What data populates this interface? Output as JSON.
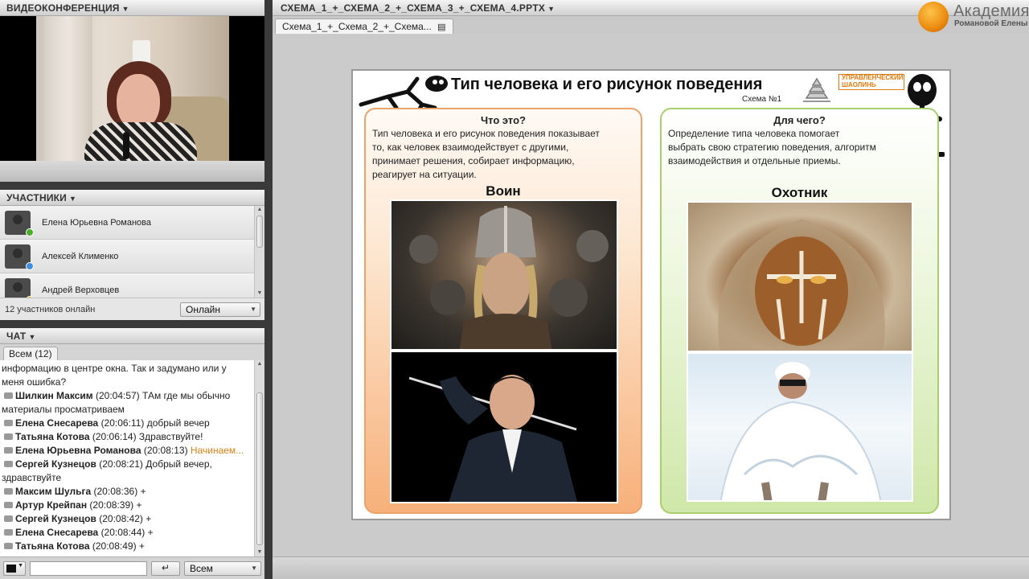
{
  "video_pod": {
    "title": "ВИДЕОКОНФЕРЕНЦИЯ"
  },
  "participants_pod": {
    "title": "УЧАСТНИКИ",
    "items": [
      {
        "name": "Елена Юрьевна Романова",
        "badge_color": "#4caf2a"
      },
      {
        "name": "Алексей Клименко",
        "badge_color": "#3d8ede"
      },
      {
        "name": "Андрей Верховцев",
        "badge_color": "#f0b400"
      }
    ],
    "online_count": "12 участников онлайн",
    "status_select": "Онлайн"
  },
  "chat_pod": {
    "title": "ЧАТ",
    "tab_label": "Всем (12)",
    "messages": [
      {
        "text": "информацию в центре окна. Так и задумано или у"
      },
      {
        "text": "меня ошибка?"
      },
      {
        "name": "Шилкин Максим",
        "time": "(20:04:57)",
        "text": "ТАм где мы обычно"
      },
      {
        "text": "материалы просматриваем"
      },
      {
        "name": "Елена Снесарева",
        "time": "(20:06:11)",
        "text": "добрый вечер"
      },
      {
        "name": "Татьяна Котова",
        "time": "(20:06:14)",
        "text": "Здравствуйте!"
      },
      {
        "name": "Елена Юрьевна Романова",
        "time": "(20:08:13)",
        "text": "Начинаем..."
      },
      {
        "name": "Сергей Кузнецов",
        "time": "(20:08:21)",
        "text": "Добрый вечер,"
      },
      {
        "text": "здравствуйте"
      },
      {
        "name": "Максим Шульга",
        "time": "(20:08:36)",
        "text": "+"
      },
      {
        "name": "Артур Крейпан",
        "time": "(20:08:39)",
        "text": "+"
      },
      {
        "name": "Сергей Кузнецов",
        "time": "(20:08:42)",
        "text": "+"
      },
      {
        "name": "Елена Снесарева",
        "time": "(20:08:44)",
        "text": "+"
      },
      {
        "name": "Татьяна Котова",
        "time": "(20:08:49)",
        "text": "+"
      }
    ],
    "input_placeholder": "",
    "send_label": "↵",
    "recipient_select": "Всем"
  },
  "share_pod": {
    "title": "СХЕМА_1_+_СХЕМА_2_+_СХЕМА_3_+_СХЕМА_4.PPTX",
    "doc_tab": "Схема_1_+_Схема_2_+_Схема..."
  },
  "logo": {
    "title": "Академия",
    "subtitle": "Романовой Елены"
  },
  "slide": {
    "title": "Тип человека и его рисунок поведения",
    "subtitle": "Схема №1",
    "publisher_logo_text": "УПРАВЛЕНЧЕСКИЙ ШАОЛИНЬ",
    "left": {
      "heading": "Что это?",
      "text_lines": [
        "Тип человека и его рисунок поведения показывает",
        "то, как человек взаимодействует с другими,",
        "принимает решения, собирает информацию,",
        "реагирует на ситуации."
      ],
      "label": "Воин"
    },
    "right": {
      "heading": "Для чего?",
      "text_lines": [
        "Определение типа человека помогает",
        "выбрать свою стратегию поведения, алгоритм",
        "взаимодействия и отдельные приемы."
      ],
      "label": "Охотник"
    }
  }
}
